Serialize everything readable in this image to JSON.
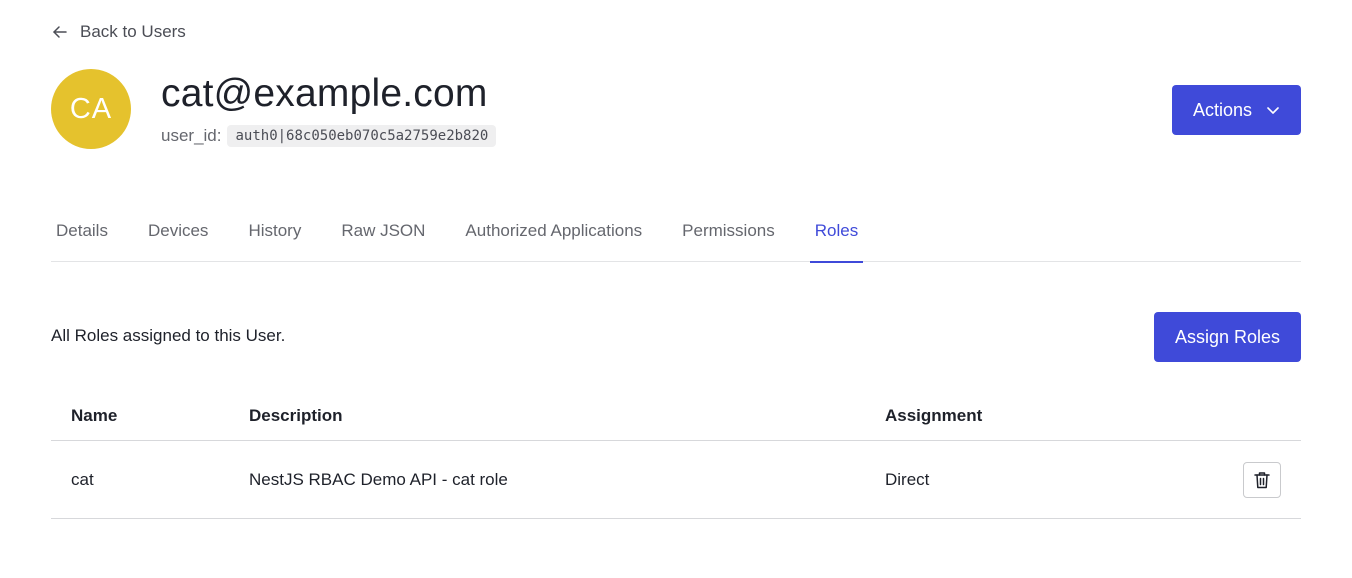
{
  "nav": {
    "back_label": "Back to Users"
  },
  "user": {
    "initials": "CA",
    "email": "cat@example.com",
    "user_id_label": "user_id:",
    "user_id_value": "auth0|68c050eb070c5a2759e2b820",
    "avatar_color": "#e5c22d"
  },
  "header": {
    "actions_label": "Actions"
  },
  "tabs": [
    {
      "label": "Details",
      "active": false
    },
    {
      "label": "Devices",
      "active": false
    },
    {
      "label": "History",
      "active": false
    },
    {
      "label": "Raw JSON",
      "active": false
    },
    {
      "label": "Authorized Applications",
      "active": false
    },
    {
      "label": "Permissions",
      "active": false
    },
    {
      "label": "Roles",
      "active": true
    }
  ],
  "roles_section": {
    "description": "All Roles assigned to this User.",
    "assign_label": "Assign Roles",
    "columns": {
      "name": "Name",
      "description": "Description",
      "assignment": "Assignment"
    },
    "rows": [
      {
        "name": "cat",
        "description": "NestJS RBAC Demo API - cat role",
        "assignment": "Direct"
      }
    ]
  },
  "colors": {
    "accent": "#3f4ad9",
    "text": "#1e212a",
    "muted": "#65676e"
  }
}
